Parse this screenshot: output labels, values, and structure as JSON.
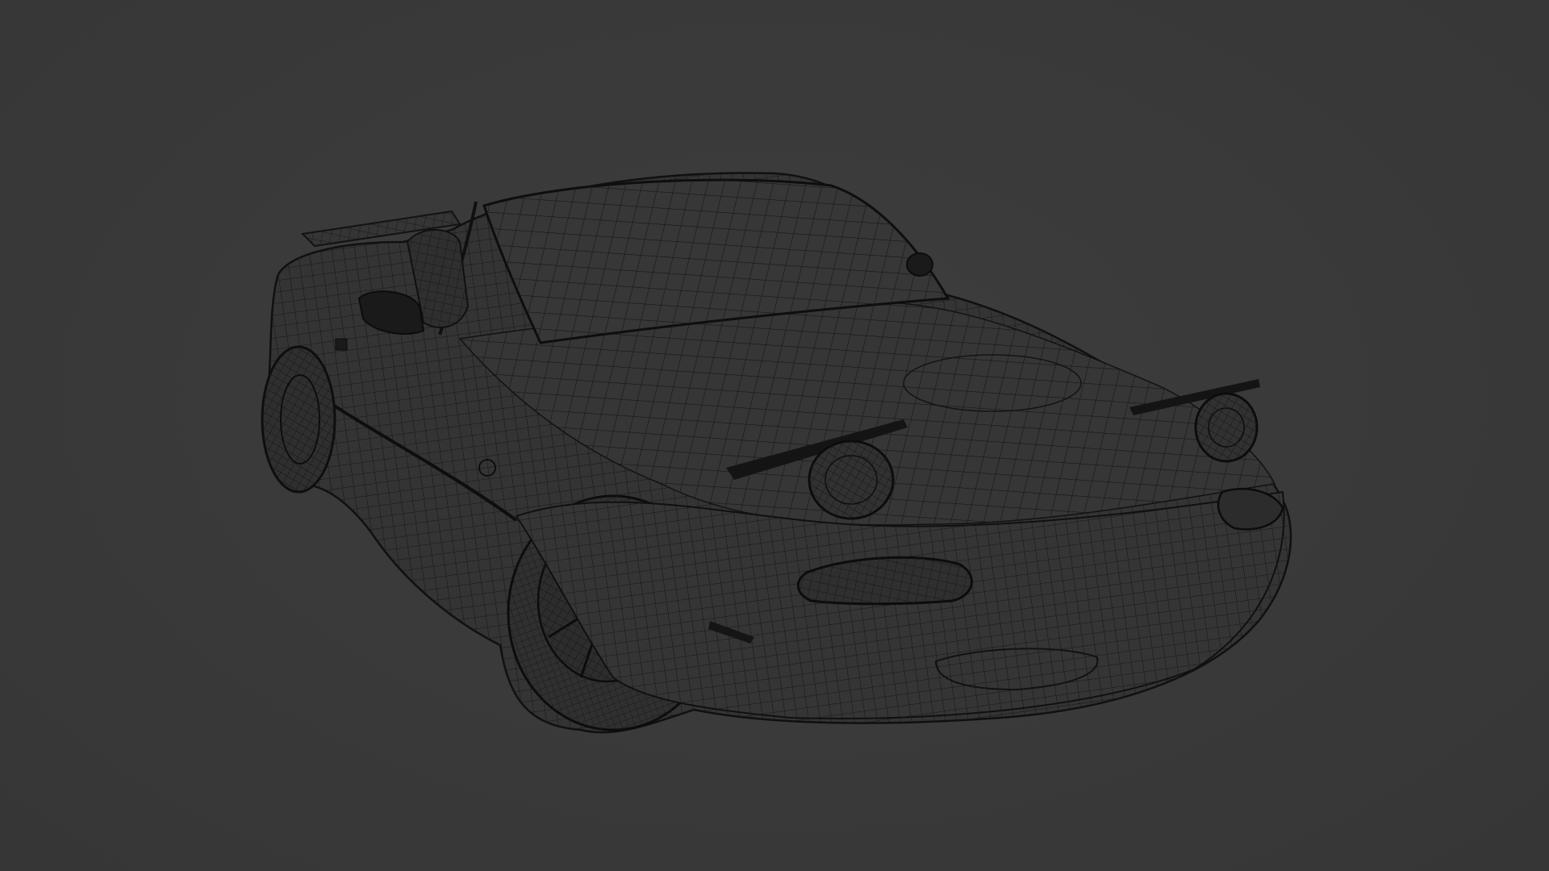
{
  "viewport": {
    "background_color": "#3a3a3a",
    "shading": "wireframe",
    "subject": "sports-car-wireframe-model"
  },
  "colors": {
    "mesh_fill": "#333333",
    "mesh_line": "#141414",
    "mesh_line_light": "#1c1c1c",
    "dark_part": "#1a1a1a"
  }
}
